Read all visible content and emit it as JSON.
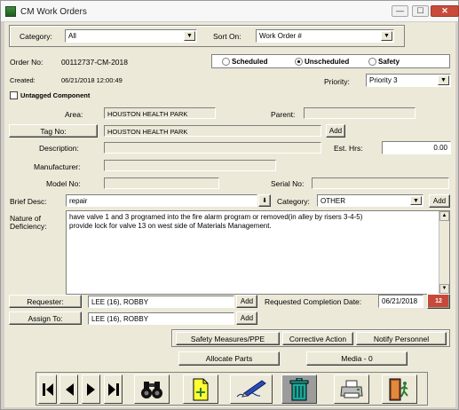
{
  "window": {
    "title": "CM Work Orders",
    "minimize": "—",
    "maximize": "☐",
    "close": "✕"
  },
  "filters": {
    "category_label": "Category:",
    "category_value": "All",
    "sort_label": "Sort On:",
    "sort_value": "Work Order #"
  },
  "order": {
    "order_no_label": "Order No:",
    "order_no": "00112737-CM-2018",
    "created_label": "Created:",
    "created": "06/21/2018  12:00:49",
    "untagged_label": "Untagged Component",
    "priority_label": "Priority:",
    "priority_value": "Priority 3"
  },
  "type_options": [
    {
      "label": "Scheduled",
      "selected": false
    },
    {
      "label": "Unscheduled",
      "selected": true
    },
    {
      "label": "Safety",
      "selected": false
    }
  ],
  "fields": {
    "area_label": "Area:",
    "area_value": "HOUSTON HEALTH PARK",
    "parent_label": "Parent:",
    "parent_value": "",
    "tag_button": "Tag No:",
    "tag_value": "HOUSTON HEALTH PARK",
    "add_label": "Add",
    "description_label": "Description:",
    "description_value": "",
    "est_hrs_label": "Est. Hrs:",
    "est_hrs_value": "0.00",
    "manufacturer_label": "Manufacturer:",
    "manufacturer_value": "",
    "model_label": "Model No:",
    "model_value": "",
    "serial_label": "Serial No:",
    "serial_value": "",
    "brief_label": "Brief Desc:",
    "brief_value": "repair",
    "category_label": "Category:",
    "category_value": "OTHER",
    "nature_label_1": "Nature of",
    "nature_label_2": "Deficiency:",
    "nature_line_1": "have valve 1 and 3 programed into the fire alarm program or removed(in alley by risers 3-4-5)",
    "nature_line_2": "provide lock for valve 13 on west side of Materials Management."
  },
  "people": {
    "requester_button": "Requester:",
    "requester_value": "LEE (16), ROBBY",
    "assign_button": "Assign To:",
    "assign_value": "LEE (16), ROBBY",
    "completion_label": "Requested Completion Date:",
    "completion_value": "06/21/2018",
    "calendar_text": "12"
  },
  "actions": {
    "safety": "Safety Measures/PPE",
    "corrective": "Corrective Action",
    "notify": "Notify Personnel",
    "allocate": "Allocate Parts",
    "media": "Media - 0"
  },
  "navigation_icons": [
    "first-record-icon",
    "previous-record-icon",
    "next-record-icon",
    "last-record-icon",
    "binoculars-icon",
    "new-document-icon",
    "signature-pen-icon",
    "trash-can-icon",
    "printer-icon",
    "exit-door-icon"
  ],
  "colors": {
    "accent_green": "#2e7d32",
    "doc_yellow": "#ffff33",
    "trash_teal": "#1aa79a"
  }
}
